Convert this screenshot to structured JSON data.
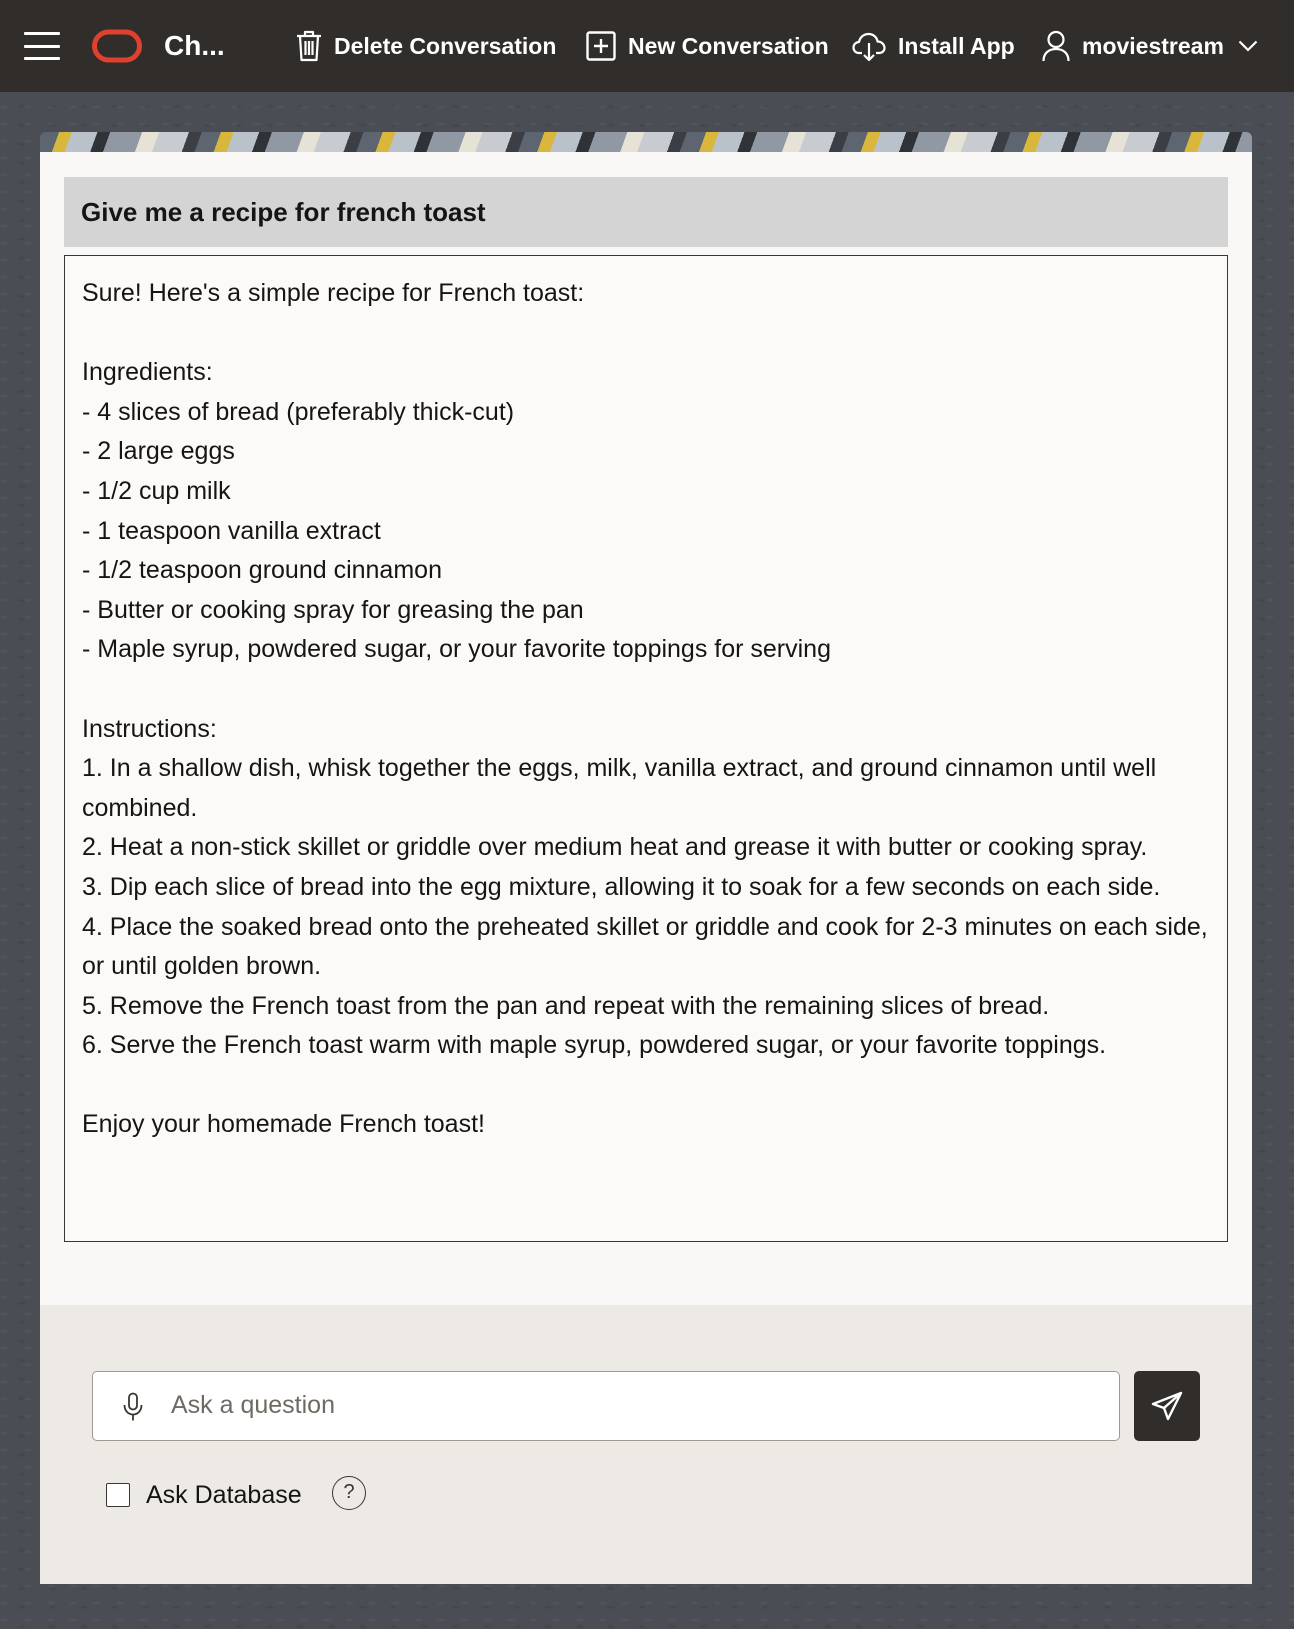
{
  "header": {
    "app_title": "Ch...",
    "delete_label": "Delete Conversation",
    "new_label": "New Conversation",
    "install_label": "Install App",
    "user_name": "moviestream",
    "brand_color": "#e0402e"
  },
  "conversation": {
    "question": "Give me a recipe for french toast",
    "answer_lines": [
      "Sure! Here's a simple recipe for French toast:",
      "",
      "Ingredients:",
      "- 4 slices of bread (preferably thick-cut)",
      "- 2 large eggs",
      "- 1/2 cup milk",
      "- 1 teaspoon vanilla extract",
      "- 1/2 teaspoon ground cinnamon",
      "- Butter or cooking spray for greasing the pan",
      "- Maple syrup, powdered sugar, or your favorite toppings for serving",
      "",
      "Instructions:",
      "1. In a shallow dish, whisk together the eggs, milk, vanilla extract, and ground cinnamon until well combined.",
      "2. Heat a non-stick skillet or griddle over medium heat and grease it with butter or cooking spray.",
      "3. Dip each slice of bread into the egg mixture, allowing it to soak for a few seconds on each side.",
      "4. Place the soaked bread onto the preheated skillet or griddle and cook for 2-3 minutes on each side, or until golden brown.",
      "5. Remove the French toast from the pan and repeat with the remaining slices of bread.",
      "6. Serve the French toast warm with maple syrup, powdered sugar, or your favorite toppings.",
      "",
      "Enjoy your homemade French toast!"
    ]
  },
  "composer": {
    "placeholder": "Ask a question",
    "value": "",
    "ask_database_label": "Ask Database",
    "ask_database_checked": false,
    "help_symbol": "?"
  },
  "icons": {
    "menu": "hamburger-menu-icon",
    "logo": "oracle-logo-icon",
    "delete": "trash-icon",
    "new": "plus-square-icon",
    "install": "cloud-download-icon",
    "user": "user-icon",
    "dropdown": "chevron-down-icon",
    "mic": "microphone-icon",
    "send": "paper-plane-icon",
    "help": "help-circle-icon"
  }
}
